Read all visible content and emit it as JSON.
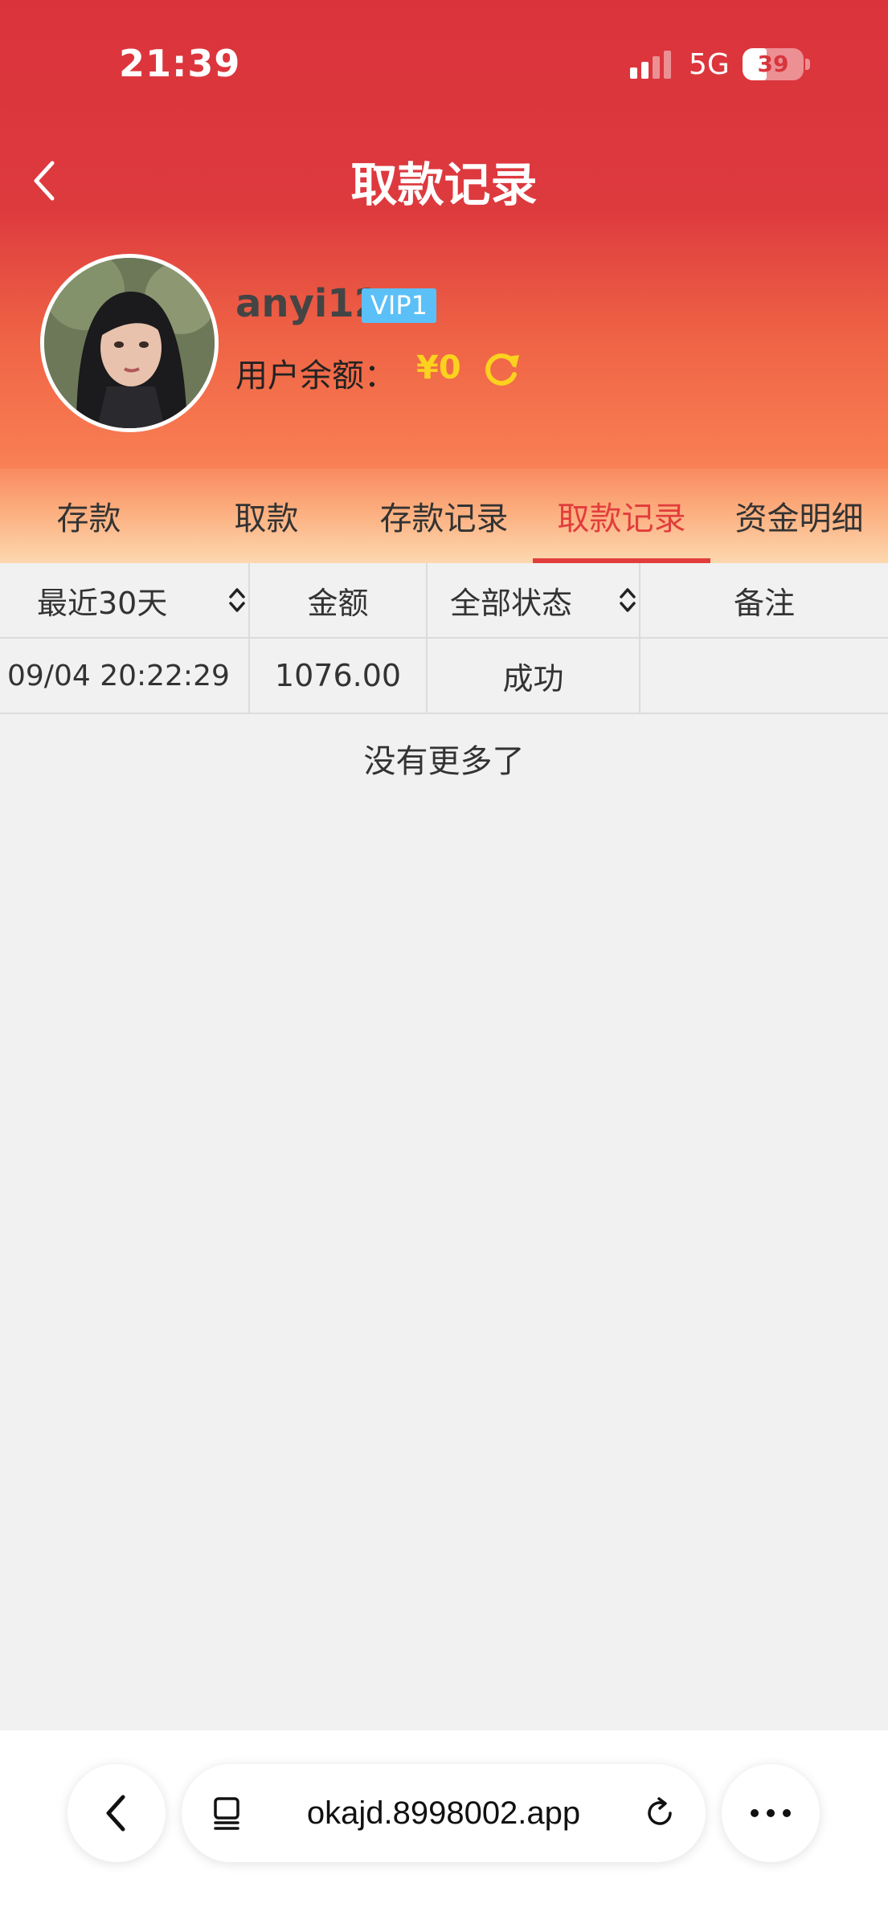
{
  "status_bar": {
    "time": "21:39",
    "network": "5G",
    "battery": "39",
    "battery_level": 0.39
  },
  "nav": {
    "title": "取款记录"
  },
  "profile": {
    "username": "anyi12",
    "vip_badge": "VIP1",
    "balance_label": "用户余额：",
    "balance_value": "¥0"
  },
  "tabs": [
    {
      "label": "存款",
      "active": false
    },
    {
      "label": "取款",
      "active": false
    },
    {
      "label": "存款记录",
      "active": false
    },
    {
      "label": "取款记录",
      "active": true
    },
    {
      "label": "资金明细",
      "active": false
    }
  ],
  "table": {
    "headers": {
      "date_filter": "最近30天",
      "amount": "金额",
      "status_filter": "全部状态",
      "note": "备注"
    },
    "rows": [
      {
        "time": "09/04 20:22:29",
        "amount": "1076.00",
        "status": "成功",
        "note": ""
      }
    ]
  },
  "footer_text": "没有更多了",
  "browser": {
    "url": "okajd.8998002.app"
  },
  "colors": {
    "header_red": "#db333c",
    "active_tab": "#e23d3d",
    "balance_gold": "#fbd21e",
    "vip_blue": "#5bc0f8"
  }
}
